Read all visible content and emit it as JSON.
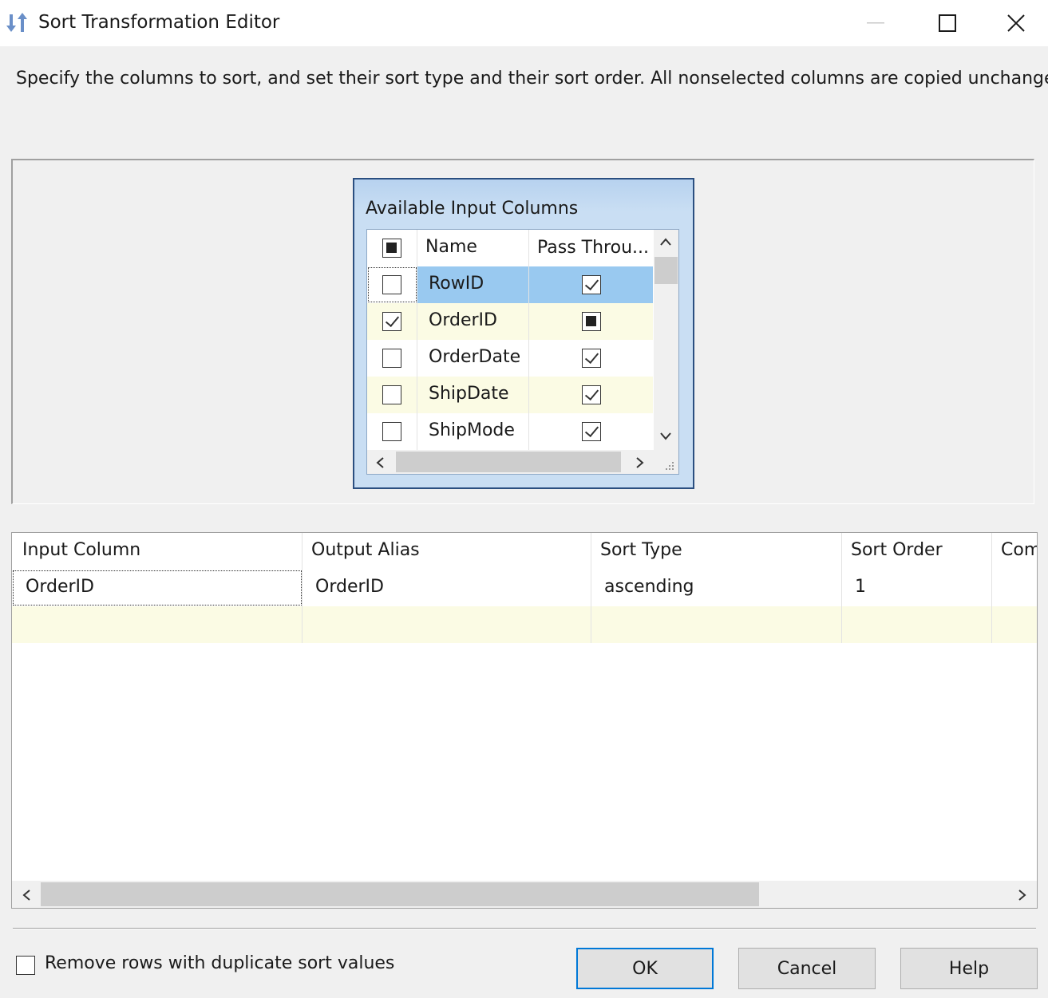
{
  "window": {
    "title": "Sort Transformation Editor",
    "icon": "sort-arrows-icon",
    "accent_color": "#0078d7"
  },
  "description": "Specify the columns to sort, and set their sort type and their sort order. All nonselected columns are copied unchanged.",
  "available_columns": {
    "title": "Available Input Columns",
    "header": {
      "name": "Name",
      "pass_through": "Pass Throu..."
    },
    "header_check_state": "indeterminate",
    "rows": [
      {
        "name": "RowID",
        "selected": false,
        "pass_through": "checked",
        "highlighted": true
      },
      {
        "name": "OrderID",
        "selected": true,
        "pass_through": "indeterminate"
      },
      {
        "name": "OrderDate",
        "selected": false,
        "pass_through": "checked"
      },
      {
        "name": "ShipDate",
        "selected": false,
        "pass_through": "checked"
      },
      {
        "name": "ShipMode",
        "selected": false,
        "pass_through": "checked"
      }
    ]
  },
  "sort_grid": {
    "headers": {
      "input_column": "Input Column",
      "output_alias": "Output Alias",
      "sort_type": "Sort Type",
      "sort_order": "Sort Order",
      "comparison": "Com"
    },
    "rows": [
      {
        "input_column": "OrderID",
        "output_alias": "OrderID",
        "sort_type": "ascending",
        "sort_order": "1",
        "comparison": ""
      }
    ]
  },
  "options": {
    "remove_duplicates_label": "Remove rows with duplicate sort values",
    "remove_duplicates_checked": false
  },
  "buttons": {
    "ok": "OK",
    "cancel": "Cancel",
    "help": "Help"
  }
}
